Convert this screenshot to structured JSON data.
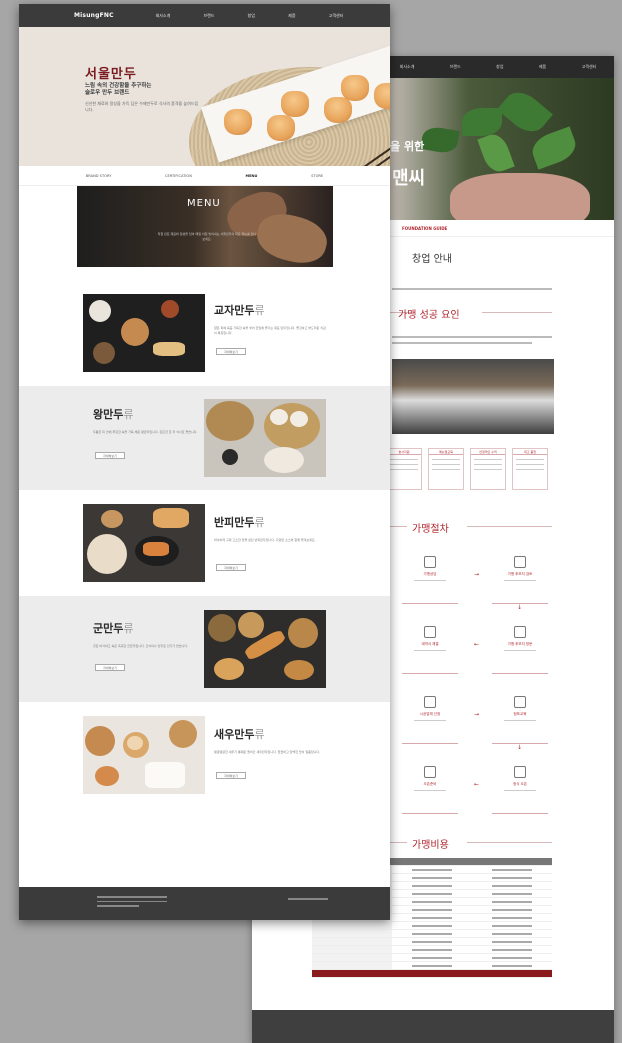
{
  "front": {
    "nav": {
      "logo": "MisungFNC",
      "items": [
        "회사소개",
        "브랜드",
        "창업",
        "제품",
        "고객센터"
      ]
    },
    "hero": {
      "title": "서울만두",
      "subtitle_line1": "느림 속의 건강함을 추구하는",
      "subtitle_line2": "슬로우 만두 브랜드",
      "description": "신선한 재료와 정성을 가득 담은 수제만두로 식사의 품격을 높여드립니다."
    },
    "tabs": [
      "BRAND STORY",
      "CERTIFICATION",
      "MENU",
      "STORE"
    ],
    "active_tab": "MENU",
    "menu_banner": {
      "title": "MENU",
      "description": "직접 만든 재료와 정성을 담아 매일 아침 빚어내는 서울만두의 대표 메뉴를 만나보세요."
    },
    "products": [
      {
        "name": "교자만두",
        "suffix": "류",
        "description": "얇은 피에 육즙 가득한 속을 넣어 한입에 즐기는 대표 만두입니다. 쫄깃하고 부드러운 식감이 특징입니다.",
        "button": "자세히보기"
      },
      {
        "name": "왕만두",
        "suffix": "류",
        "description": "두툼한 피 안에 푸짐한 속을 가득 채운 왕만두입니다. 든든한 한 끼 식사로 좋습니다.",
        "button": "자세히보기"
      },
      {
        "name": "반피만두",
        "suffix": "류",
        "description": "바삭하게 구워 고소한 맛을 살린 반피만두입니다. 다양한 소스와 함께 즐겨보세요.",
        "button": "자세히보기"
      },
      {
        "name": "군만두",
        "suffix": "류",
        "description": "겉은 바삭하고 속은 촉촉한 군만두입니다. 간식이나 안주로 인기가 많습니다.",
        "button": "자세히보기"
      },
      {
        "name": "새우만두",
        "suffix": "류",
        "description": "탱글탱글한 새우가 통째로 들어간 새우만두입니다. 깔끔하고 담백한 맛이 일품입니다.",
        "button": "자세히보기"
      }
    ]
  },
  "back": {
    "nav": {
      "items": [
        "회사소개",
        "브랜드",
        "창업",
        "제품",
        "고객센터"
      ]
    },
    "hero": {
      "line1": "을 위한",
      "line2": "맨씨"
    },
    "tab_label": "FOUNDATION GUIDE",
    "sections": {
      "guide_title": "창업 안내",
      "success_title": "가맹 성공 요인",
      "process_title": "가맹절차",
      "cost_title": "가맹비용"
    },
    "cards": [
      "본사지원",
      "매뉴얼교육",
      "안정적인 수익",
      "최고 품질"
    ],
    "steps": [
      "가맹상담",
      "가맹 후보지 검토",
      "계약서 체결",
      "가맹 후보지 방문",
      "시공업체 선정",
      "점포교육",
      "오픈준비",
      "정식 오픈"
    ]
  },
  "colors": {
    "brand_red": "#7a1a1e",
    "accent_red": "#b0262e",
    "nav_dark": "#3b3b3b",
    "background": "#a6a6a6"
  }
}
